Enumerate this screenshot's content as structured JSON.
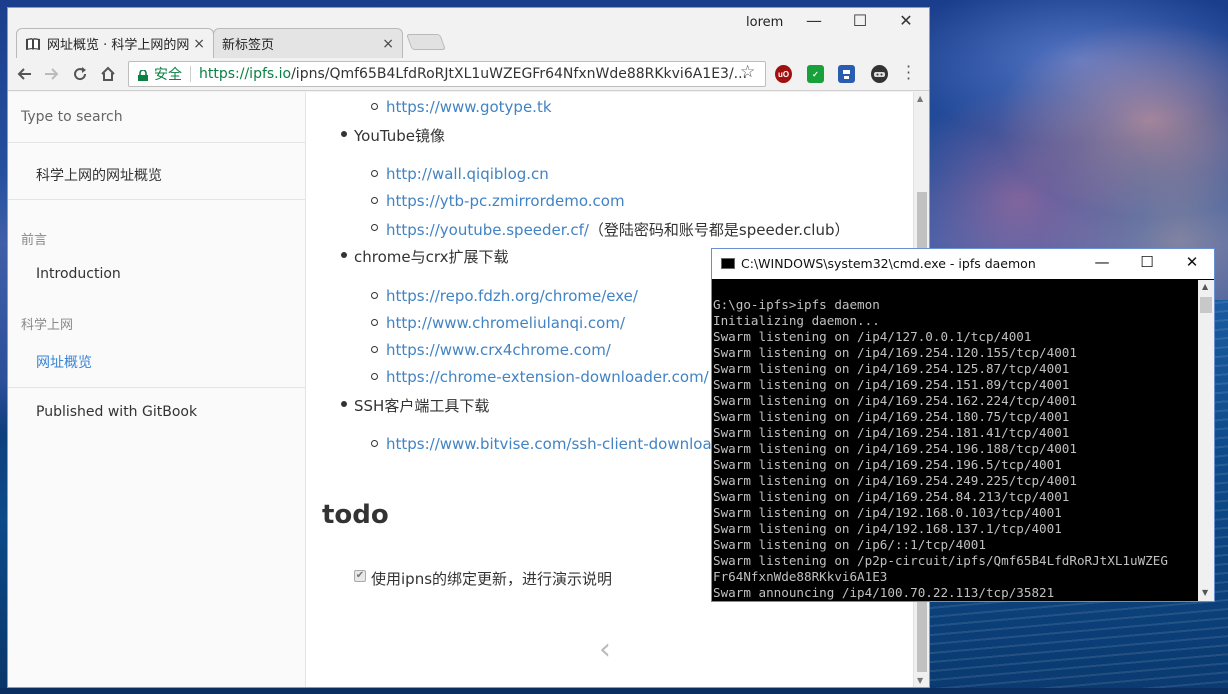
{
  "browser": {
    "tabs": [
      {
        "title": "网址概览 · 科学上网的网",
        "close": "×"
      },
      {
        "title": "新标签页",
        "close": "×"
      }
    ],
    "user": "lorem",
    "window_controls": {
      "minimize": "—",
      "maximize": "☐",
      "close": "✕"
    },
    "security_label": "安全",
    "url_scheme_host": "https://ipfs.io",
    "url_path": "/ipns/Qmf65B4LfdRoRJtXL1uWZEGFr64NfxnWde88RKkvi6A1E3/..."
  },
  "sidebar": {
    "search_placeholder": "Type to search",
    "book_title": "科学上网的网址概览",
    "section1_header": "前言",
    "intro": "Introduction",
    "section2_header": "科学上网",
    "current": "网址概览",
    "published": "Published with GitBook"
  },
  "content": {
    "items": [
      {
        "link": "https://www.gotype.tk",
        "suffix": ""
      },
      {
        "heading": "YouTube镜像"
      },
      {
        "link": "http://wall.qiqiblog.cn",
        "suffix": ""
      },
      {
        "link": "https://ytb-pc.zmirrordemo.com",
        "suffix": ""
      },
      {
        "link": "https://youtube.speeder.cf/",
        "suffix": "（登陆密码和账号都是speeder.club）"
      },
      {
        "heading": "chrome与crx扩展下载"
      },
      {
        "link": "https://repo.fdzh.org/chrome/exe/",
        "suffix": ""
      },
      {
        "link": "http://www.chromeliulanqi.com/",
        "suffix": ""
      },
      {
        "link": "https://www.crx4chrome.com/",
        "suffix": ""
      },
      {
        "link": "https://chrome-extension-downloader.com/",
        "suffix": ""
      },
      {
        "heading": "SSH客户端工具下载"
      },
      {
        "link": "https://www.bitvise.com/ssh-client-download",
        "suffix": ""
      }
    ],
    "todo_heading": "todo",
    "todo_check": "✔",
    "todo_item": "使用ipns的绑定更新，进行演示说明",
    "prev_arrow": "‹"
  },
  "cmd": {
    "title": "C:\\WINDOWS\\system32\\cmd.exe - ipfs  daemon",
    "controls": {
      "minimize": "—",
      "maximize": "☐",
      "close": "✕"
    },
    "lines": [
      "G:\\go-ipfs>ipfs daemon",
      "Initializing daemon...",
      "Swarm listening on /ip4/127.0.0.1/tcp/4001",
      "Swarm listening on /ip4/169.254.120.155/tcp/4001",
      "Swarm listening on /ip4/169.254.125.87/tcp/4001",
      "Swarm listening on /ip4/169.254.151.89/tcp/4001",
      "Swarm listening on /ip4/169.254.162.224/tcp/4001",
      "Swarm listening on /ip4/169.254.180.75/tcp/4001",
      "Swarm listening on /ip4/169.254.181.41/tcp/4001",
      "Swarm listening on /ip4/169.254.196.188/tcp/4001",
      "Swarm listening on /ip4/169.254.196.5/tcp/4001",
      "Swarm listening on /ip4/169.254.249.225/tcp/4001",
      "Swarm listening on /ip4/169.254.84.213/tcp/4001",
      "Swarm listening on /ip4/192.168.0.103/tcp/4001",
      "Swarm listening on /ip4/192.168.137.1/tcp/4001",
      "Swarm listening on /ip6/::1/tcp/4001",
      "Swarm listening on /p2p-circuit/ipfs/Qmf65B4LfdRoRJtXL1uWZEG",
      "Fr64NfxnWde88RKkvi6A1E3",
      "Swarm announcing /ip4/100.70.22.113/tcp/35821"
    ]
  },
  "extensions": [
    {
      "name": "ublock-icon",
      "label": "uO",
      "color": "#a01010"
    },
    {
      "name": "shield-extension-icon",
      "label": "✓",
      "color": "#18a03a"
    },
    {
      "name": "save-extension-icon",
      "label": "",
      "color": "#2a5cb0"
    },
    {
      "name": "ninja-extension-icon",
      "label": "",
      "color": "#333333"
    }
  ]
}
